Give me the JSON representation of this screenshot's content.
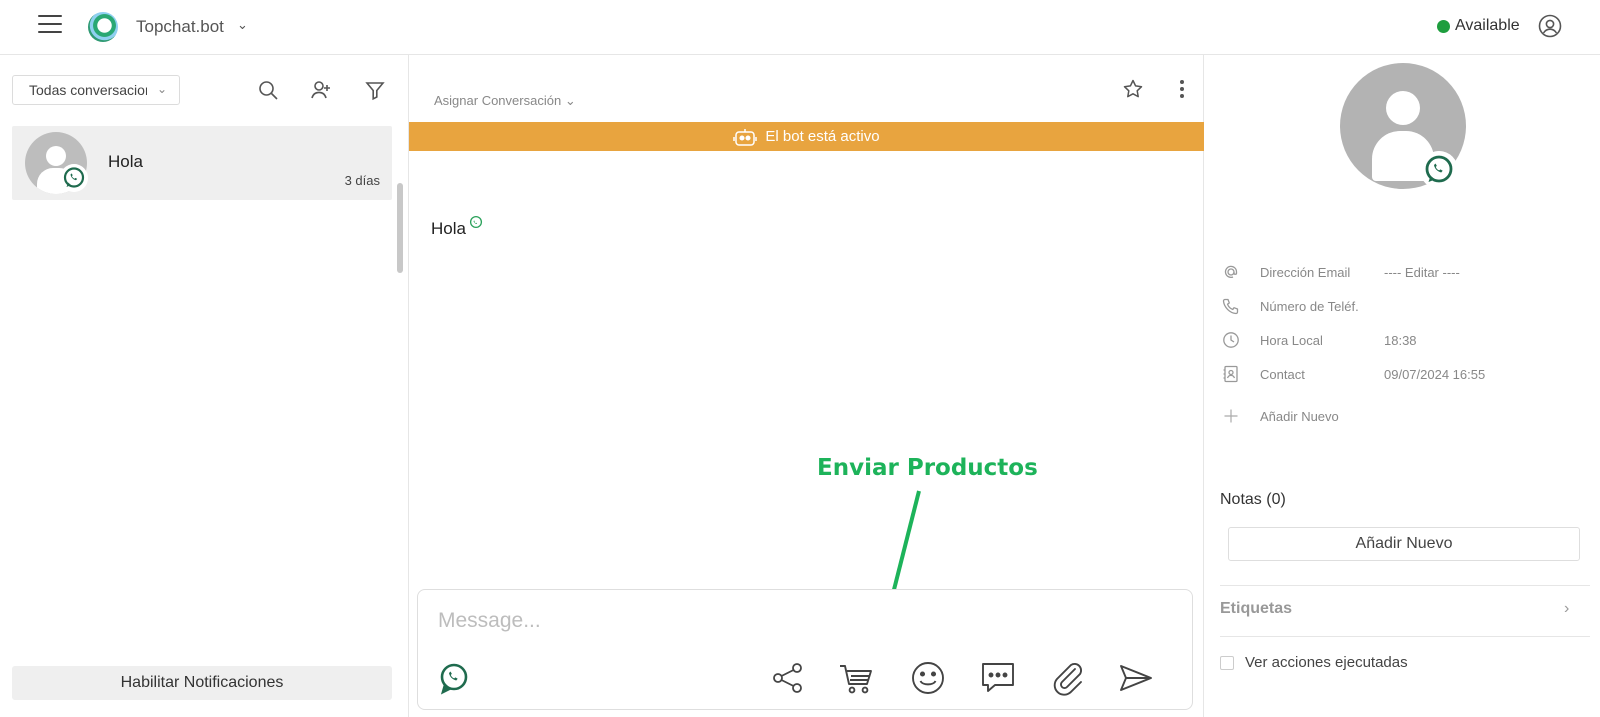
{
  "topbar": {
    "brand": "Topchat.bot",
    "status": "Available",
    "status_color": "#1e9e3e"
  },
  "left": {
    "filter_label": "Todas conversaciones",
    "conversations": [
      {
        "name": "Hola",
        "time": "3 días"
      }
    ],
    "notif_button": "Habilitar Notificaciones"
  },
  "chat": {
    "assign_label": "Asignar Conversación",
    "bot_banner": "El bot está activo",
    "bot_banner_color": "#e8a43f",
    "messages": [
      {
        "text": "Hola"
      }
    ],
    "annotation": "Enviar Productos",
    "annotation_color": "#1db35a",
    "composer_placeholder": "Message...",
    "composer_icons": [
      "whatsapp-icon",
      "share-icon",
      "cart-icon",
      "emoji-icon",
      "chat-bubble-icon",
      "paperclip-icon",
      "send-icon"
    ]
  },
  "contact": {
    "fields": [
      {
        "label": "Dirección Email",
        "value": "---- Editar ----",
        "icon": "at-icon"
      },
      {
        "label": "Número de Teléf.",
        "value": "",
        "icon": "phone-icon"
      },
      {
        "label": "Hora Local",
        "value": "18:38",
        "icon": "clock-icon"
      },
      {
        "label": "Contact",
        "value": "09/07/2024 16:55",
        "icon": "contact-card-icon"
      }
    ],
    "add_new": "Añadir Nuevo",
    "notes_title": "Notas (0)",
    "notes_add_button": "Añadir Nuevo",
    "tags_title": "Etiquetas",
    "actions_checkbox": "Ver acciones ejecutadas"
  }
}
